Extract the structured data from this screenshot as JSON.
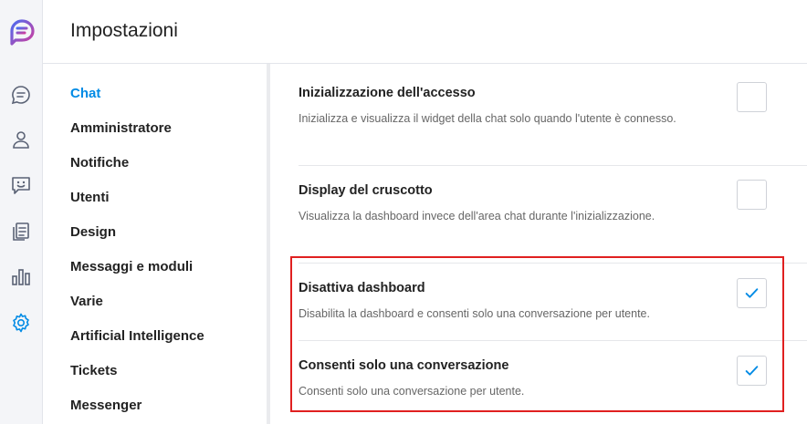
{
  "header": {
    "title": "Impostazioni"
  },
  "colors": {
    "accent": "#028be5",
    "highlight": "#e02020"
  },
  "rail": {
    "icons": [
      "conversations-icon",
      "users-icon",
      "chat-support-icon",
      "articles-icon",
      "reports-icon",
      "settings-icon"
    ]
  },
  "menu": {
    "items": [
      {
        "label": "Chat",
        "active": true
      },
      {
        "label": "Amministratore"
      },
      {
        "label": "Notifiche"
      },
      {
        "label": "Utenti"
      },
      {
        "label": "Design"
      },
      {
        "label": "Messaggi e moduli"
      },
      {
        "label": "Varie"
      },
      {
        "label": "Artificial Intelligence"
      },
      {
        "label": "Tickets"
      },
      {
        "label": "Messenger"
      }
    ]
  },
  "settings": [
    {
      "title": "Inizializzazione dell'accesso",
      "description": "Inizializza e visualizza il widget della chat solo quando l'utente è connesso.",
      "checked": false
    },
    {
      "title": "Display del cruscotto",
      "description": "Visualizza la dashboard invece dell'area chat durante l'inizializzazione.",
      "checked": false
    },
    {
      "title": "Disattiva dashboard",
      "description": "Disabilita la dashboard e consenti solo una conversazione per utente.",
      "checked": true
    },
    {
      "title": "Consenti solo una conversazione",
      "description": "Consenti solo una conversazione per utente.",
      "checked": true
    }
  ]
}
